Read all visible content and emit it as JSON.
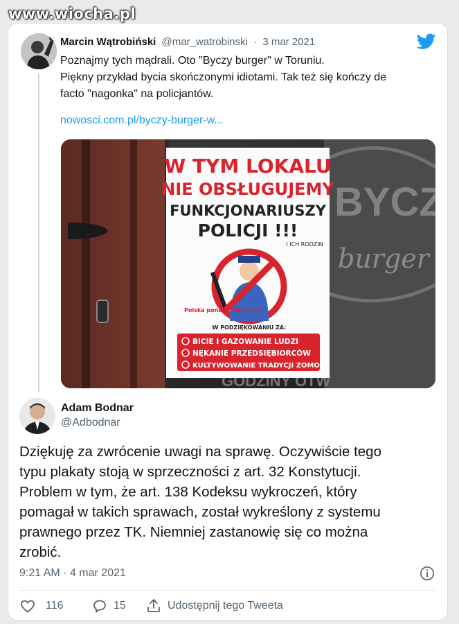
{
  "watermark": {
    "text": "www.wiocha.pl"
  },
  "quoted_tweet": {
    "author_name": "Marcin Wątrobiński",
    "handle": "@mar_watrobinski",
    "separator": "·",
    "date": "3 mar 2021",
    "text_lines": [
      "Poznajmy tych mądrali. Oto \"Byczy burger\" w Toruniu.",
      "Piękny przykład bycia skończonymi idiotami. Tak też się kończy de",
      "facto \"nagonka\" na policjantów."
    ],
    "link": "nowosci.com.pl/byczy-burger-w...",
    "photo": {
      "poster_line1": "W TYM LOKALU",
      "poster_line2": "NIE OBSŁUGUJEMY",
      "poster_line3": "FUNKCJONARIUSZY",
      "poster_line4": "POLICJI !!!",
      "poster_line5": "I ICH RODZIN",
      "poster_logo": "Polska ponad podziałami",
      "poster_thanks": "W PODZIĘKOWANIU ZA:",
      "poster_reasons": [
        "BICIE I GAZOWANIE LUDZI",
        "NĘKANIE PRZEDSIĘBIORCÓW",
        "KULTYWOWANIE TRADYCJI ZOMO"
      ],
      "window_text1": "BYCZ",
      "window_text2": "burger",
      "window_bottom": "GODZINY OTW"
    }
  },
  "main_tweet": {
    "author_name": "Adam Bodnar",
    "handle": "@Adbodnar",
    "text_lines": [
      "Dziękuję za zwrócenie uwagi na sprawę. Oczywiście tego",
      "typu plakaty stoją w sprzeczności z art. 32 Konstytucji.",
      "Problem w tym, że art. 138 Kodeksu wykroczeń, który",
      "pomagał w takich sprawach, został wykreślony z systemu",
      "prawnego przez TK. Niemniej zastanowię się co można",
      "zrobić."
    ],
    "time": "9:21 AM",
    "separator": "·",
    "date": "4 mar 2021",
    "likes": "116",
    "replies": "15",
    "share_label": "Udostępnij tego Tweeta"
  },
  "icons": [
    "twitter-logo-icon",
    "info-icon",
    "heart-icon",
    "reply-icon",
    "share-icon"
  ],
  "colors": {
    "twitter_blue": "#1d9bf0",
    "text": "#0f1419",
    "muted": "#536471",
    "poster_red": "#d9232d"
  }
}
